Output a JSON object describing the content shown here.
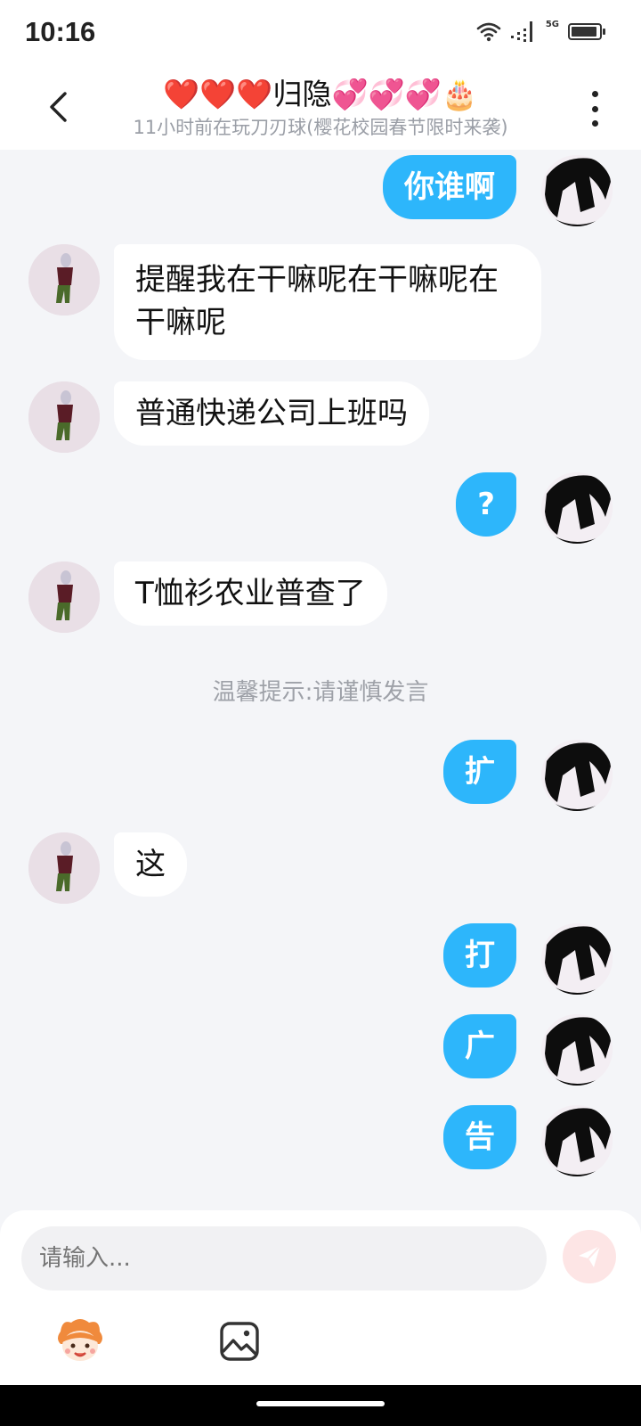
{
  "status_bar": {
    "time": "10:16",
    "network": "5G"
  },
  "header": {
    "title": "❤️❤️❤️归隐💞💞💞🎂",
    "subtitle": "11小时前在玩刀刃球(樱花校园春节限时来袭)"
  },
  "messages": [
    {
      "side": "right",
      "text": "你谁啊"
    },
    {
      "side": "left",
      "text": "提醒我在干嘛呢在干嘛呢在干嘛呢"
    },
    {
      "side": "left",
      "text": "普通快递公司上班吗"
    },
    {
      "side": "right",
      "text": "?"
    },
    {
      "side": "left",
      "text": "T恤衫农业普查了"
    },
    {
      "side": "right",
      "text": "扩"
    },
    {
      "side": "left",
      "text": "这"
    },
    {
      "side": "right",
      "text": "打"
    },
    {
      "side": "right",
      "text": "广"
    },
    {
      "side": "right",
      "text": "告"
    }
  ],
  "tip": "温馨提示:请谨慎发言",
  "input": {
    "placeholder": "请输入..."
  },
  "icons": {
    "back": "back-arrow-icon",
    "more": "more-vertical-icon",
    "send": "send-icon",
    "emoji": "emoji-sticker-icon",
    "image": "image-icon"
  },
  "colors": {
    "accent": "#2db6fb",
    "background": "#f4f5f8",
    "bubble_left": "#ffffff",
    "send_button": "#fde5e5"
  }
}
